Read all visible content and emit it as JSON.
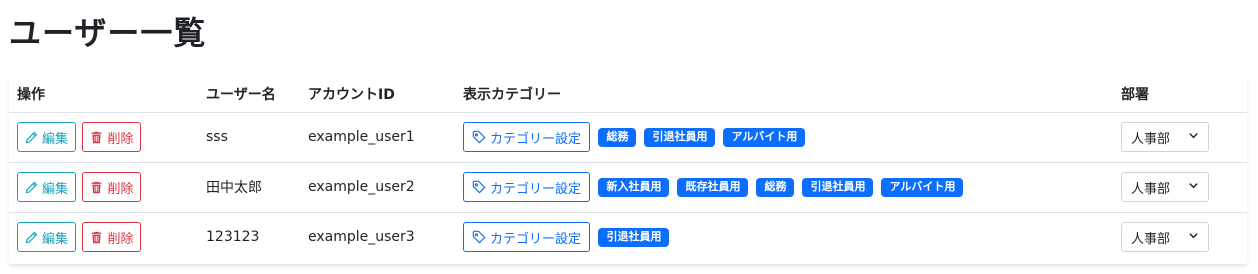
{
  "page": {
    "title": "ユーザー一覧"
  },
  "table": {
    "headers": {
      "operation": "操作",
      "username": "ユーザー名",
      "account_id": "アカウントID",
      "categories": "表示カテゴリー",
      "department": "部署"
    },
    "edit_label": "編集",
    "delete_label": "削除",
    "category_button_label": "カテゴリー設定",
    "rows": [
      {
        "username": "sss",
        "account_id": "example_user1",
        "categories": [
          "総務",
          "引退社員用",
          "アルバイト用"
        ],
        "department": "人事部"
      },
      {
        "username": "田中太郎",
        "account_id": "example_user2",
        "categories": [
          "新入社員用",
          "既存社員用",
          "総務",
          "引退社員用",
          "アルバイト用"
        ],
        "department": "人事部"
      },
      {
        "username": "123123",
        "account_id": "example_user3",
        "categories": [
          "引退社員用"
        ],
        "department": "人事部"
      }
    ]
  },
  "colors": {
    "edit": "#17a2b8",
    "delete": "#dc3545",
    "primary": "#0d6efd"
  },
  "icons": {
    "edit": "pencil-icon",
    "delete": "trash-icon",
    "category": "tag-icon",
    "dropdown": "chevron-down-icon"
  }
}
